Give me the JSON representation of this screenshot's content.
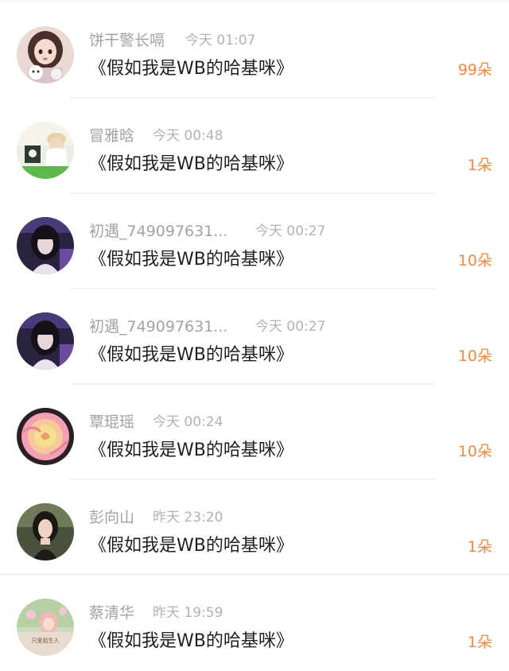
{
  "comments": [
    {
      "name": "饼干警长嗝",
      "time": "今天 01:07",
      "text": "《假如我是WB的哈基咪》",
      "gift": "99朵"
    },
    {
      "name": "冒雅晗",
      "time": "今天 00:48",
      "text": "《假如我是WB的哈基咪》",
      "gift": "1朵"
    },
    {
      "name": "初遇_749097631...",
      "time": "今天 00:27",
      "text": "《假如我是WB的哈基咪》",
      "gift": "10朵"
    },
    {
      "name": "初遇_749097631...",
      "time": "今天 00:27",
      "text": "《假如我是WB的哈基咪》",
      "gift": "10朵"
    },
    {
      "name": "覃琨瑶",
      "time": "今天 00:24",
      "text": "《假如我是WB的哈基咪》",
      "gift": "10朵"
    },
    {
      "name": "彭向山",
      "time": "昨天 23:20",
      "text": "《假如我是WB的哈基咪》",
      "gift": "1朵"
    },
    {
      "name": "蔡清华",
      "time": "昨天 19:59",
      "text": "《假如我是WB的哈基咪》",
      "gift": "1朵"
    }
  ],
  "avatar_caption": "只爱陌生人",
  "colors": {
    "gift": "#f08a3e",
    "name": "#a3a3a3",
    "time": "#b3b3b3",
    "title": "#1f1f1f"
  }
}
